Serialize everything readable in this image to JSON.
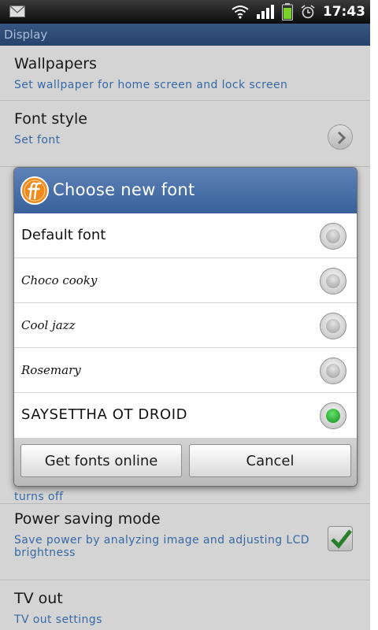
{
  "status_bar": {
    "time": "17:43",
    "icons": [
      "mail-icon",
      "wifi-icon",
      "signal-icon",
      "battery-icon",
      "alarm-icon"
    ]
  },
  "section_header": "Display",
  "settings": [
    {
      "title": "Wallpapers",
      "subtitle": "Set wallpaper for home screen and lock screen"
    },
    {
      "title": "Font style",
      "subtitle": "Set font"
    },
    {
      "subtitle": "turns off"
    },
    {
      "title": "Power saving mode",
      "subtitle": "Save power by analyzing image and adjusting LCD brightness",
      "checked": true
    },
    {
      "title": "TV out",
      "subtitle": "TV out settings"
    }
  ],
  "dialog": {
    "title": "Choose new font",
    "options": [
      {
        "label": "Default font",
        "selected": false
      },
      {
        "label": "Choco cooky",
        "selected": false
      },
      {
        "label": "Cool jazz",
        "selected": false
      },
      {
        "label": "Rosemary",
        "selected": false
      },
      {
        "label": "SAYSETTHA OT DROID",
        "selected": true
      }
    ],
    "buttons": {
      "get_fonts": "Get fonts online",
      "cancel": "Cancel"
    }
  },
  "colors": {
    "header_blue": "#38609a",
    "subtitle_blue": "#3c72b6",
    "selected_green": "#1fa82a"
  }
}
